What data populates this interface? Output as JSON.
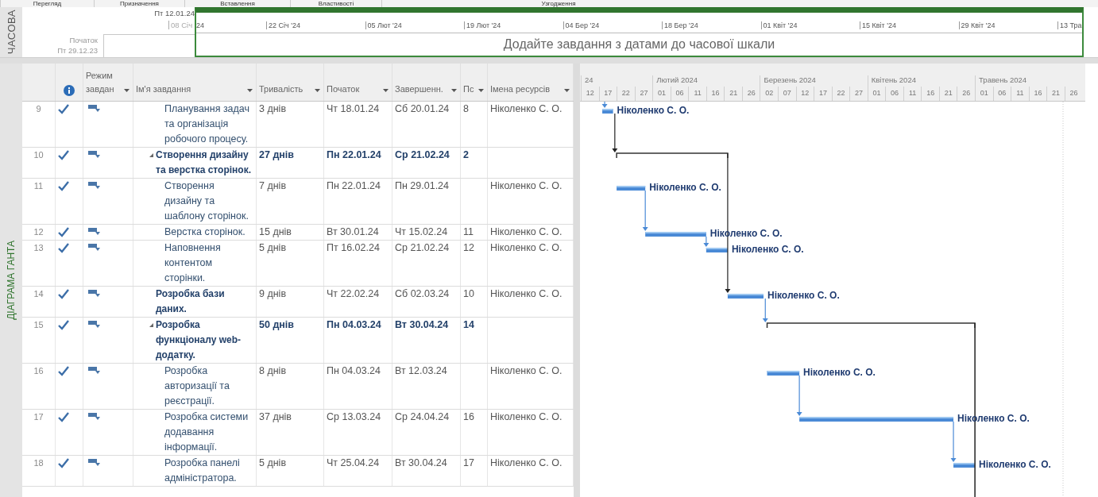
{
  "ribbon_tabs": [
    "Перегляд",
    "Призначення",
    "Вставлення",
    "Властивості",
    "Узгодження"
  ],
  "timeline": {
    "side_label": "ЧАСОВА",
    "current_date": "Пт 12.01.24",
    "first_tick": {
      "before_box": "08 Січ",
      "inside_box": "24"
    },
    "start_label": "Початок",
    "start_date": "Пт 29.12.23",
    "ticks": [
      "22 Січ '24",
      "05 Лют '24",
      "19 Лют '24",
      "04 Бер '24",
      "18 Бер '24",
      "01 Квіт '24",
      "15 Квіт '24",
      "29 Квіт '24",
      "13 Тра"
    ],
    "placeholder": "Додайте завдання з датами до часової шкали"
  },
  "view_label": "ДІАГРАМА ГАНТА",
  "table": {
    "columns": [
      {
        "kind": "info"
      },
      {
        "kind": "text",
        "label": "Режим завдан"
      },
      {
        "kind": "text",
        "label": "Ім'я завдання"
      },
      {
        "kind": "text",
        "label": "Тривалість"
      },
      {
        "kind": "text",
        "label": "Початок"
      },
      {
        "kind": "text",
        "label": "Завершенн."
      },
      {
        "kind": "text",
        "label": "Пс"
      },
      {
        "kind": "text",
        "label": "Імена ресурсів"
      }
    ],
    "rows": [
      {
        "id": "9",
        "kind": "task",
        "done": true,
        "name": "Планування задач та організація робочого процесу.",
        "duration": "3 днів",
        "start": "Чт 18.01.24",
        "finish": "Сб 20.01.24",
        "predecessors": "8",
        "link_in": true,
        "link_dark": false,
        "resources": "Ніколенко С. О.",
        "bar_label": "Ніколенко С. О."
      },
      {
        "id": "10",
        "kind": "summary",
        "expanded": true,
        "done": true,
        "name": "Створення дизайну та верстка сторінок.",
        "duration": "27 днів",
        "start": "Пн 22.01.24",
        "finish": "Ср 21.02.24",
        "predecessors": "2",
        "link_in": true,
        "link_dark": true,
        "link_out_below": false
      },
      {
        "id": "11",
        "kind": "task",
        "done": true,
        "name": "Створення дизайну та шаблону сторінок.",
        "duration": "7 днів",
        "start": "Пн 22.01.24",
        "finish": "Пн 29.01.24",
        "resources": "Ніколенко С. О.",
        "bar_label": "Ніколенко С. О."
      },
      {
        "id": "12",
        "kind": "task",
        "done": true,
        "name": "Верстка сторінок.",
        "duration": "15 днів",
        "start": "Вт 30.01.24",
        "finish": "Чт 15.02.24",
        "predecessors": "11",
        "link_in": true,
        "link_dark": false,
        "resources": "Ніколенко С. О.",
        "bar_label": "Ніколенко С. О."
      },
      {
        "id": "13",
        "kind": "task",
        "done": true,
        "name": "Наповнення контентом сторінки.",
        "duration": "5 днів",
        "start": "Пт 16.02.24",
        "finish": "Ср 21.02.24",
        "predecessors": "12",
        "link_in": true,
        "link_dark": false,
        "resources": "Ніколенко С. О.",
        "bar_label": "Ніколенко С. О."
      },
      {
        "id": "14",
        "kind": "top_task",
        "done": true,
        "name": "Розробка бази даних.",
        "duration": "9 днів",
        "start": "Чт 22.02.24",
        "finish": "Сб 02.03.24",
        "predecessors": "10",
        "link_in": true,
        "link_dark": true,
        "resources": "Ніколенко С. О.",
        "bar_label": "Ніколенко С. О."
      },
      {
        "id": "15",
        "kind": "summary",
        "expanded": true,
        "done": true,
        "name": "Розробка функціоналу web-додатку.",
        "duration": "50 днів",
        "start": "Пн 04.03.24",
        "finish": "Вт 30.04.24",
        "predecessors": "14",
        "link_in": true,
        "link_dark": false,
        "link_out_below": true
      },
      {
        "id": "16",
        "kind": "task",
        "done": true,
        "name": "Розробка авторизації та реєстрації.",
        "duration": "8 днів",
        "start": "Пн 04.03.24",
        "finish": "Вт 12.03.24",
        "resources": "Ніколенко С. О.",
        "bar_label": "Ніколенко С. О."
      },
      {
        "id": "17",
        "kind": "task",
        "done": true,
        "name": "Розробка системи додавання інформації.",
        "duration": "37 днів",
        "start": "Ср 13.03.24",
        "finish": "Ср 24.04.24",
        "predecessors": "16",
        "link_in": true,
        "link_dark": false,
        "resources": "Ніколенко С. О.",
        "bar_label": "Ніколенко С. О."
      },
      {
        "id": "18",
        "kind": "task",
        "done": true,
        "name": "Розробка панелі адміністратора.",
        "duration": "5 днів",
        "start": "Чт 25.04.24",
        "finish": "Вт 30.04.24",
        "predecessors": "17",
        "link_in": true,
        "link_dark": false,
        "resources": "Ніколенко С. О.",
        "bar_label": "Ніколенко С. О."
      }
    ]
  },
  "gantt": {
    "months": [
      {
        "label": "24",
        "days": [
          "12",
          "17",
          "22",
          "27"
        ]
      },
      {
        "label": "Лютий 2024",
        "days": [
          "01",
          "06",
          "11",
          "16",
          "21",
          "26"
        ]
      },
      {
        "label": "Березень 2024",
        "days": [
          "02",
          "07",
          "12",
          "17",
          "22",
          "27"
        ]
      },
      {
        "label": "Квітень 2024",
        "days": [
          "01",
          "06",
          "11",
          "16",
          "21",
          "26"
        ]
      },
      {
        "label": "Травень 2024",
        "days": [
          "01",
          "06",
          "11",
          "16",
          "21",
          "26"
        ]
      }
    ]
  }
}
